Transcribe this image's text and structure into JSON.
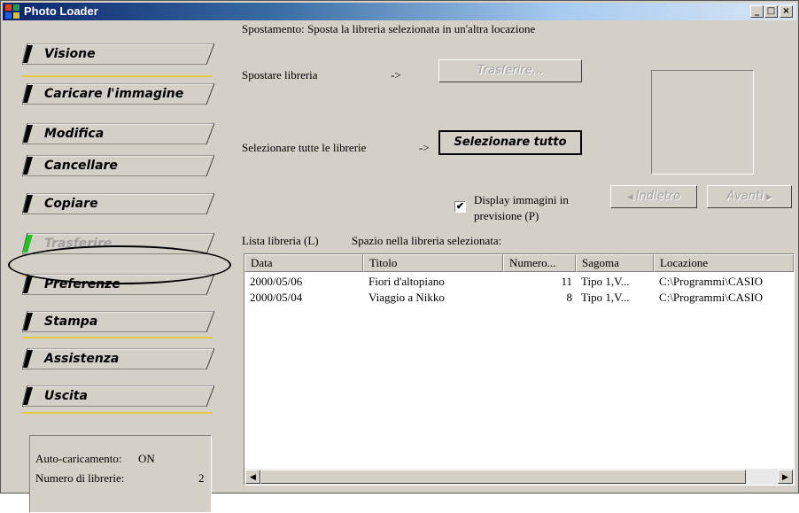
{
  "window": {
    "title": "Photo Loader",
    "minimize": "_",
    "maximize": "□",
    "close": "×"
  },
  "sidebar": {
    "items": [
      {
        "label": "Visione",
        "enabled": true,
        "indicator": "#000000"
      },
      {
        "label": "Caricare l'immagine",
        "enabled": true,
        "indicator": "#000000"
      },
      {
        "label": "Modifica",
        "enabled": true,
        "indicator": "#000000"
      },
      {
        "label": "Cancellare",
        "enabled": true,
        "indicator": "#000000"
      },
      {
        "label": "Copiare",
        "enabled": true,
        "indicator": "#000000"
      },
      {
        "label": "Trasferire",
        "enabled": false,
        "indicator": "#1ac81a"
      },
      {
        "label": "Preferenze",
        "enabled": true,
        "indicator": "#000000"
      },
      {
        "label": "Stampa",
        "enabled": true,
        "indicator": "#000000"
      },
      {
        "label": "Assistenza",
        "enabled": true,
        "indicator": "#000000"
      },
      {
        "label": "Uscita",
        "enabled": true,
        "indicator": "#000000"
      }
    ],
    "status": {
      "autoload_label": "Auto-caricamento:",
      "autoload_value": "ON",
      "count_label": "Numero di librerie:",
      "count_value": "2"
    }
  },
  "main": {
    "heading": "Spostamento: Sposta la libreria selezionata in un'altra locazione",
    "move_label": "Spostare libreria",
    "arrow1": "->",
    "transfer_button": "Trasferire...",
    "select_all_label": "Selezionare tutte le librerie",
    "arrow2": "->",
    "select_all_button": "Selezionare tutto",
    "preview_checkbox": {
      "line1": "Display immagini in",
      "line2": "previsione (P)",
      "checked": true
    },
    "back_button": "Indietro",
    "forward_button": "Avanti",
    "list_label": "Lista libreria (L)",
    "space_label": "Spazio nella libreria selezionata:",
    "table": {
      "columns": [
        "Data",
        "Titolo",
        "Numero...",
        "Sagoma",
        "Locazione"
      ],
      "rows": [
        {
          "data": "2000/05/06",
          "titolo": "Fiori d'altopiano",
          "numero": "11",
          "sagoma": "Tipo 1,V...",
          "locazione": "C:\\Programmi\\CASIO"
        },
        {
          "data": "2000/05/04",
          "titolo": "Viaggio a Nikko",
          "numero": "8",
          "sagoma": "Tipo 1,V...",
          "locazione": "C:\\Programmi\\CASIO"
        }
      ]
    }
  },
  "colors": {
    "face": "#d4d0c8",
    "accent": "#e8c840",
    "title_start": "#0a246a"
  }
}
